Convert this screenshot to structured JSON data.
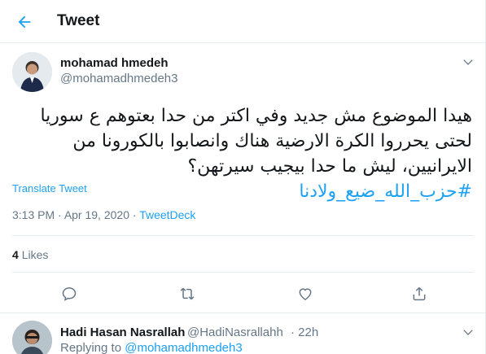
{
  "header": {
    "title": "Tweet"
  },
  "tweet": {
    "author_name": "mohamad hmedeh",
    "author_handle": "@mohamadhmedeh3",
    "text_main": "هيدا الموضوع مش جديد وفي اكتر من حدا بعتوهم ع سوريا لحتى يحرروا الكرة الارضية هناك وانصابوا بالكورونا من الايرانيين، ليش ما حدا بيجيب سيرتهن؟ ",
    "hashtag": "#حزب_الله_ضيع_ولادنا",
    "translate_label": "Translate Tweet",
    "time": "3:13 PM",
    "date": "Apr 19, 2020",
    "source": "TweetDeck",
    "likes_count": "4",
    "likes_label": "Likes"
  },
  "reply": {
    "author_name": "Hadi Hasan Nasrallah",
    "author_handle": "@HadiNasrallahh",
    "time": "22h",
    "replying_prefix": "Replying to",
    "replying_to": "@mohamadhmedeh3"
  },
  "icons": {
    "back": "arrow-left-icon",
    "caret": "chevron-down-icon",
    "reply": "comment-icon",
    "retweet": "retweet-icon",
    "like": "heart-icon",
    "share": "share-icon"
  },
  "colors": {
    "accent": "#1da1f2",
    "text": "#14171a",
    "muted": "#657786",
    "border": "#e6ecf0"
  }
}
